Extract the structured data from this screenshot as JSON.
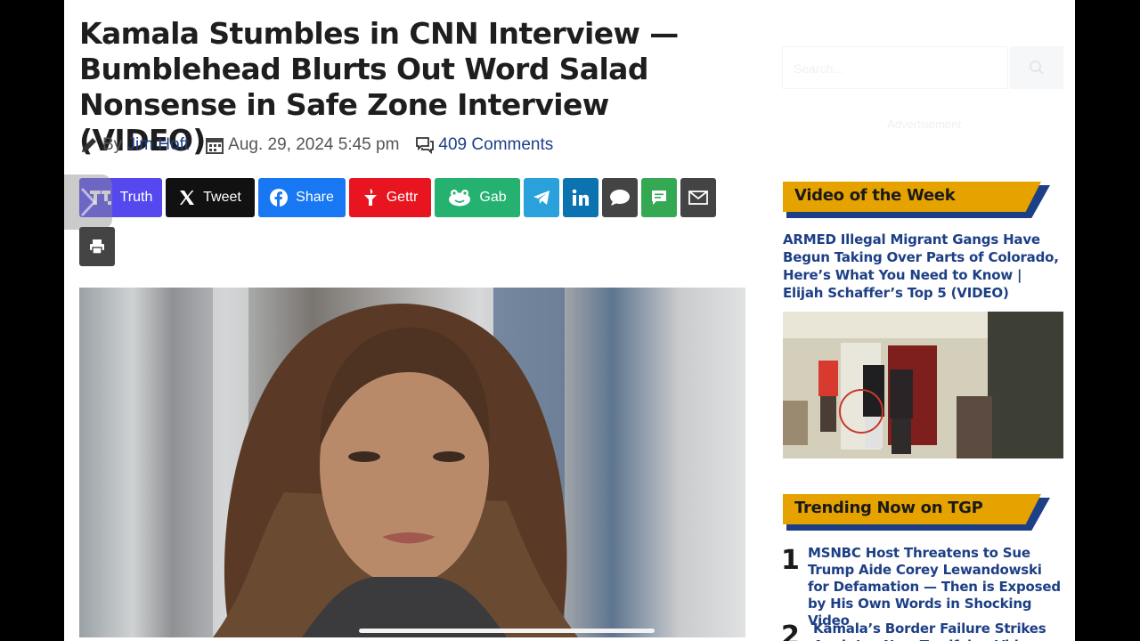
{
  "article": {
    "headline": "Kamala Stumbles in CNN Interview — Bumblehead Blurts Out Word Salad Nonsense in Safe Zone Interview (VIDEO)",
    "by_label": "By",
    "author": "Jim Hoft",
    "date": "Aug. 29, 2024 5:45 pm",
    "comments": "409 Comments"
  },
  "share": {
    "buttons": [
      {
        "label": "Truth",
        "color": "#5448ee",
        "icon": "truth-social-icon"
      },
      {
        "label": "Tweet",
        "color": "#111111",
        "icon": "x-icon"
      },
      {
        "label": "Share",
        "color": "#1877f2",
        "icon": "facebook-icon"
      },
      {
        "label": "Gettr",
        "color": "#e8141f",
        "icon": "gettr-icon"
      },
      {
        "label": "Gab",
        "color": "#25b170",
        "icon": "gab-icon"
      }
    ],
    "icon_buttons": [
      {
        "name": "telegram-button",
        "color": "#2aa1da",
        "icon": "telegram-icon"
      },
      {
        "name": "linkedin-button",
        "color": "#0a73b0",
        "icon": "linkedin-icon"
      },
      {
        "name": "comment-button",
        "color": "#444444",
        "icon": "speech-bubble-icon"
      },
      {
        "name": "sms-button",
        "color": "#34a853",
        "icon": "message-icon"
      },
      {
        "name": "email-button",
        "color": "#444444",
        "icon": "envelope-icon"
      }
    ],
    "print_icon": "printer-icon"
  },
  "sidebar": {
    "search_placeholder": "Search...",
    "faint_text": "Advertisement",
    "video_heading": "Video of the Week",
    "video_title": "ARMED Illegal Migrant Gangs Have Begun Taking Over Parts of Colorado, Here’s What You Need to Know | Elijah Schaffer’s Top 5 (VIDEO)",
    "trending_heading": "Trending Now on TGP",
    "trending": [
      {
        "num": "1",
        "title": "MSNBC Host Threatens to Sue Trump Aide Corey Lewandowski for Defamation — Then is Exposed by His Own Words in Shocking Video"
      },
      {
        "num": "2",
        "title": "Kamala’s Border Failure Strikes Again! — New Terrifying Video"
      }
    ]
  },
  "colors": {
    "brand_blue": "#1d3f86",
    "accent_gold": "#e6a300"
  }
}
